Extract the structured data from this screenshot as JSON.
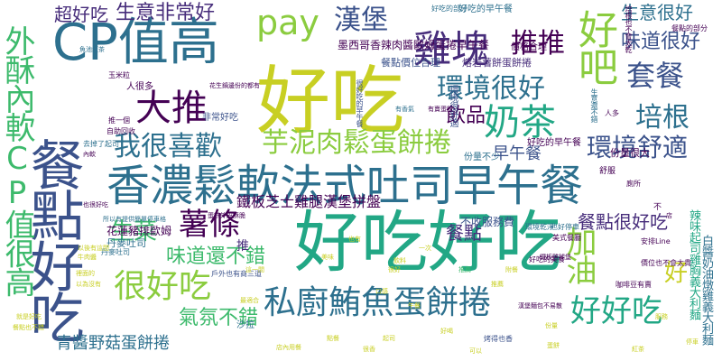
{
  "palette": {
    "yellow": "#c8cf23",
    "lime": "#8bcc3f",
    "green": "#3dba6c",
    "teal": "#22a785",
    "cyan": "#1f968b",
    "blue": "#2d708e",
    "indigo": "#3b528b",
    "purple": "#472d7b",
    "dark": "#440154"
  },
  "words": {
    "w01": "好吃",
    "w02": "好吃好吃",
    "w03": "香濃鬆軟法式吐司早午餐",
    "w04": "CP值高",
    "w05": "餐點好吃",
    "w06": "外酥內軟CP值很高",
    "w07": "雞塊",
    "w08": "好吧",
    "w09": "私廚鮪魚蛋餅捲",
    "w10": "大推",
    "w11": "薯條",
    "w12": "奶茶",
    "w13": "環境很好",
    "w14": "套餐",
    "w15": "芋泥肉鬆蛋餅捲",
    "w16": "我很喜歡",
    "w17": "很好吃",
    "w18": "好好吃",
    "w19": "加油",
    "w20": "pay",
    "w21": "漢堡",
    "w22": "推推",
    "w23": "環境舒適",
    "w24": "培根",
    "w25": "生意很好",
    "w26": "味道很好",
    "w27": "生意非常好",
    "w28": "超好吃",
    "w29": "飲品",
    "w30": "早午餐",
    "w31": "生菜",
    "w32": "味道還不錯",
    "w33": "氣氛不錯",
    "w34": "青醬野菇蛋餅捲",
    "w35": "餐點很好吃",
    "w36": "餐點",
    "w37": "鐵板芝士雞腿漢堡拼盤",
    "w38": "好",
    "w39": "辣味起司雞胸義大利麵",
    "w40": "墨西哥香辣肉醬歐姆蛋捲早午餐",
    "w41": "餐點價位合理",
    "w42": "熔岩薯餅蛋餅捲",
    "w43": "價格合理",
    "w44": "不收服務費",
    "w45": "花蓮豬排歐姆",
    "w46": "丹麥吐司",
    "w47": "推",
    "w48": "沙拉",
    "w49": "份量很大",
    "w50": "份量不少",
    "w51": "非常好吃",
    "w52": "人很多",
    "w53": "環境很舒適",
    "w54": "好吃的早午餐",
    "w55": "餐點的部分",
    "w56": "好吃的早午餐",
    "w57": "自助回收",
    "w58": "推一個",
    "w59": "去掉了起司",
    "w60": "丹麥吐司",
    "w61": "白醬奶油燉雞義大利麵",
    "w62": "好吃的美食",
    "w63": "舒服",
    "w64": "廁所",
    "w65": "不",
    "w66": "也好停車",
    "w67": "美式餐廳",
    "w68": "環境乾淨",
    "w69": "人多",
    "w70": "有賣蛋餅",
    "w71": "生意還不錯",
    "w72": "很好吃的早午餐",
    "w73": "安排Line",
    "w74": "價位也不會太貴",
    "w75": "咖啡豆有賣",
    "w76": "戶外也有商三道",
    "w77": "鐵板雞腿堡",
    "w78": "漢堡麵包不易散",
    "w79": "推薦",
    "w80": "店",
    "w81": "烤得也香",
    "w82": "蛋餅外皮酥脆",
    "w83": "所以有提供簡單停車格",
    "w84": "也很好吃",
    "w85": "內軟",
    "w86": "玉米粒",
    "w87": "魚池紅茶",
    "w88": "花生鍋邊份的都有",
    "w89": "好吃的部分",
    "w90": "培根也不會太乾",
    "w91": "以後有這間",
    "w92": "牛肉醬",
    "w93": "有香氣",
    "w94": "裡面的",
    "w95": "以為沒有",
    "w96": "餐點也不錯",
    "w97": "就是好吃",
    "w98": "店內用餐",
    "w99": "這一間",
    "w100": "最適合",
    "w101": "也有",
    "w102": "很好",
    "w103": "很香",
    "w104": "起司",
    "w105": "可以",
    "w106": "一次",
    "w107": "口感",
    "w108": "附餐",
    "w109": "點餐",
    "w110": "推薦",
    "w111": "好喝",
    "w112": "飲料",
    "w113": "美味",
    "w114": "午餐",
    "w115": "份量",
    "w116": "服務",
    "w117": "停車",
    "w118": "蛋餅",
    "w119": "紅茶"
  }
}
